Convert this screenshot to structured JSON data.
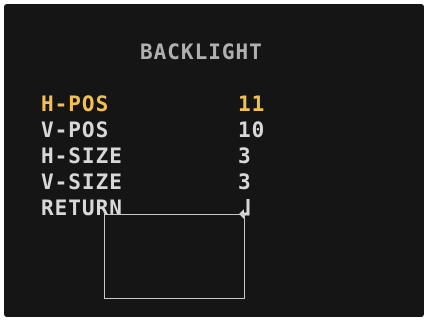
{
  "osd": {
    "title": "BACKLIGHT",
    "selected_color": "#f3c04e",
    "normal_color": "#d8d8d8",
    "title_color": "#b0b0b0",
    "background_color": "#151515",
    "items": [
      {
        "label": "H-POS",
        "value": "11",
        "selected": true
      },
      {
        "label": "V-POS",
        "value": "10",
        "selected": false
      },
      {
        "label": "H-SIZE",
        "value": "3",
        "selected": false
      },
      {
        "label": "V-SIZE",
        "value": "3",
        "selected": false
      },
      {
        "label": "RETURN",
        "icon": "return-arrow-icon",
        "selected": false
      }
    ]
  }
}
